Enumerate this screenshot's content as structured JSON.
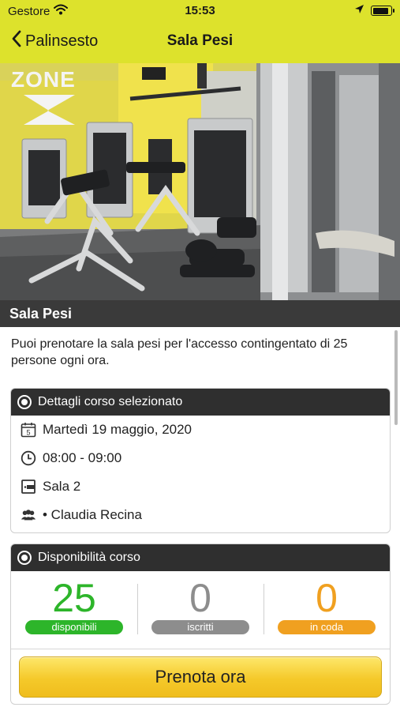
{
  "status_bar": {
    "carrier": "Gestore",
    "time": "15:53",
    "battery_level": 0.92
  },
  "nav": {
    "back_label": "Palinsesto",
    "title": "Sala Pesi"
  },
  "hero": {
    "caption": "Sala Pesi",
    "wall_text": "ZONE"
  },
  "intro": "Puoi prenotare la sala pesi per l'accesso contingentato di 25 persone ogni ora.",
  "details_card": {
    "header": "Dettagli corso selezionato",
    "date_day": "5",
    "date": "Martedì 19 maggio, 2020",
    "time": "08:00 - 09:00",
    "room": "Sala 2",
    "instructor": "• Claudia Recina",
    "icons": [
      "calendar-icon",
      "clock-icon",
      "room-icon",
      "people-icon"
    ]
  },
  "availability_card": {
    "header": "Disponibilità corso",
    "counters": [
      {
        "value": "25",
        "label": "disponibili",
        "color": "#2db52a"
      },
      {
        "value": "0",
        "label": "iscritti",
        "color": "#8d8d8d"
      },
      {
        "value": "0",
        "label": "in coda",
        "color": "#f0a020"
      }
    ],
    "book_button": "Prenota ora"
  },
  "colors": {
    "accent": "#dde22c",
    "dark_header": "#2f2f2f",
    "button": "#f5c92a"
  }
}
